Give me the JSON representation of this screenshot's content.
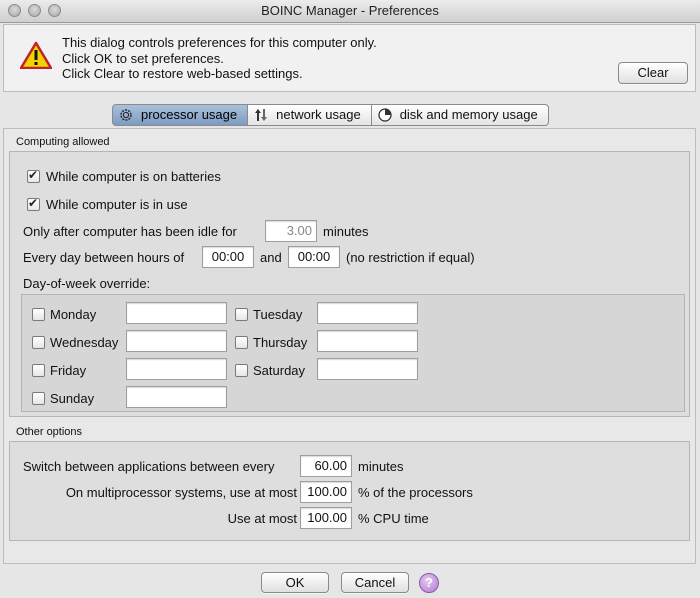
{
  "window": {
    "title": "BOINC Manager - Preferences"
  },
  "notice": {
    "line1": "This dialog controls preferences for this computer only.",
    "line2": "Click OK to set preferences.",
    "line3": "Click Clear to restore web-based settings.",
    "clear_label": "Clear"
  },
  "tabs": [
    {
      "label": "processor usage",
      "icon": "gear-icon",
      "active": true
    },
    {
      "label": "network usage",
      "icon": "network-arrows-icon",
      "active": false
    },
    {
      "label": "disk and memory usage",
      "icon": "disk-pie-icon",
      "active": false
    }
  ],
  "computing": {
    "section_label": "Computing allowed",
    "on_batteries_label": "While computer is on batteries",
    "on_batteries_checked": true,
    "in_use_label": "While computer is in use",
    "in_use_checked": true,
    "idle_label": "Only after computer has been idle for",
    "idle_value": "3.00",
    "idle_unit": "minutes",
    "hours_label": "Every day between hours of",
    "hours_start": "00:00",
    "hours_and": "and",
    "hours_end": "00:00",
    "hours_note": "(no restriction if equal)",
    "dow_label": "Day-of-week override:",
    "days": [
      {
        "label": "Monday",
        "checked": false,
        "value": ""
      },
      {
        "label": "Tuesday",
        "checked": false,
        "value": ""
      },
      {
        "label": "Wednesday",
        "checked": false,
        "value": ""
      },
      {
        "label": "Thursday",
        "checked": false,
        "value": ""
      },
      {
        "label": "Friday",
        "checked": false,
        "value": ""
      },
      {
        "label": "Saturday",
        "checked": false,
        "value": ""
      },
      {
        "label": "Sunday",
        "checked": false,
        "value": ""
      }
    ]
  },
  "other": {
    "section_label": "Other options",
    "switch_label": "Switch between applications between every",
    "switch_value": "60.00",
    "switch_unit": "minutes",
    "multi_label": "On multiprocessor systems, use at most",
    "multi_value": "100.00",
    "multi_unit": "% of the processors",
    "cpu_label": "Use at most",
    "cpu_value": "100.00",
    "cpu_unit": "% CPU time"
  },
  "footer": {
    "ok_label": "OK",
    "cancel_label": "Cancel",
    "help_label": "?"
  },
  "colors": {
    "active_tab": "#7d9cc2",
    "warning_yellow": "#f2d200",
    "warning_red": "#c0242a",
    "help_purple": "#b07ad0"
  }
}
